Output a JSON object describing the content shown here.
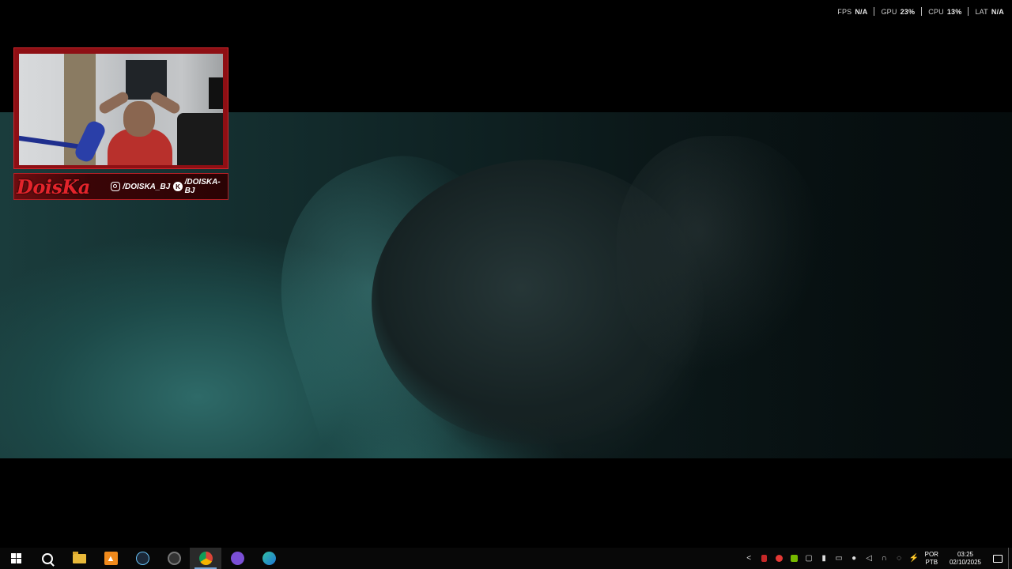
{
  "perf_overlay": {
    "fps": {
      "key": "FPS",
      "value": "N/A"
    },
    "gpu": {
      "key": "GPU",
      "value": "23%"
    },
    "cpu": {
      "key": "CPU",
      "value": "13%"
    },
    "lat": {
      "key": "LAT",
      "value": "N/A"
    }
  },
  "webcam_overlay": {
    "logo_text": "DoisKa",
    "instagram_handle": "/DOISKA_BJ",
    "kick_handle": "/DOISKA-BJ"
  },
  "taskbar": {
    "pinned": [
      {
        "name": "start",
        "icon": "windows-logo-icon"
      },
      {
        "name": "search",
        "icon": "search-icon"
      },
      {
        "name": "file-explorer",
        "icon": "folder-icon"
      },
      {
        "name": "app-orange",
        "icon": "orange-app-icon"
      },
      {
        "name": "steam",
        "icon": "steam-icon"
      },
      {
        "name": "app-dark",
        "icon": "dark-circle-app-icon"
      },
      {
        "name": "chrome",
        "icon": "chrome-icon",
        "active": true
      },
      {
        "name": "app-purple",
        "icon": "purple-app-icon"
      },
      {
        "name": "edge",
        "icon": "edge-icon"
      }
    ],
    "tray": {
      "language_line1": "POR",
      "language_line2": "PTB",
      "time": "03:25",
      "date": "02/10/2025"
    }
  },
  "colors": {
    "overlay_red": "#d2262c",
    "banner_dark": "#2a0304",
    "taskbar_bg": "#080808",
    "active_indicator": "#7aa7d8"
  }
}
